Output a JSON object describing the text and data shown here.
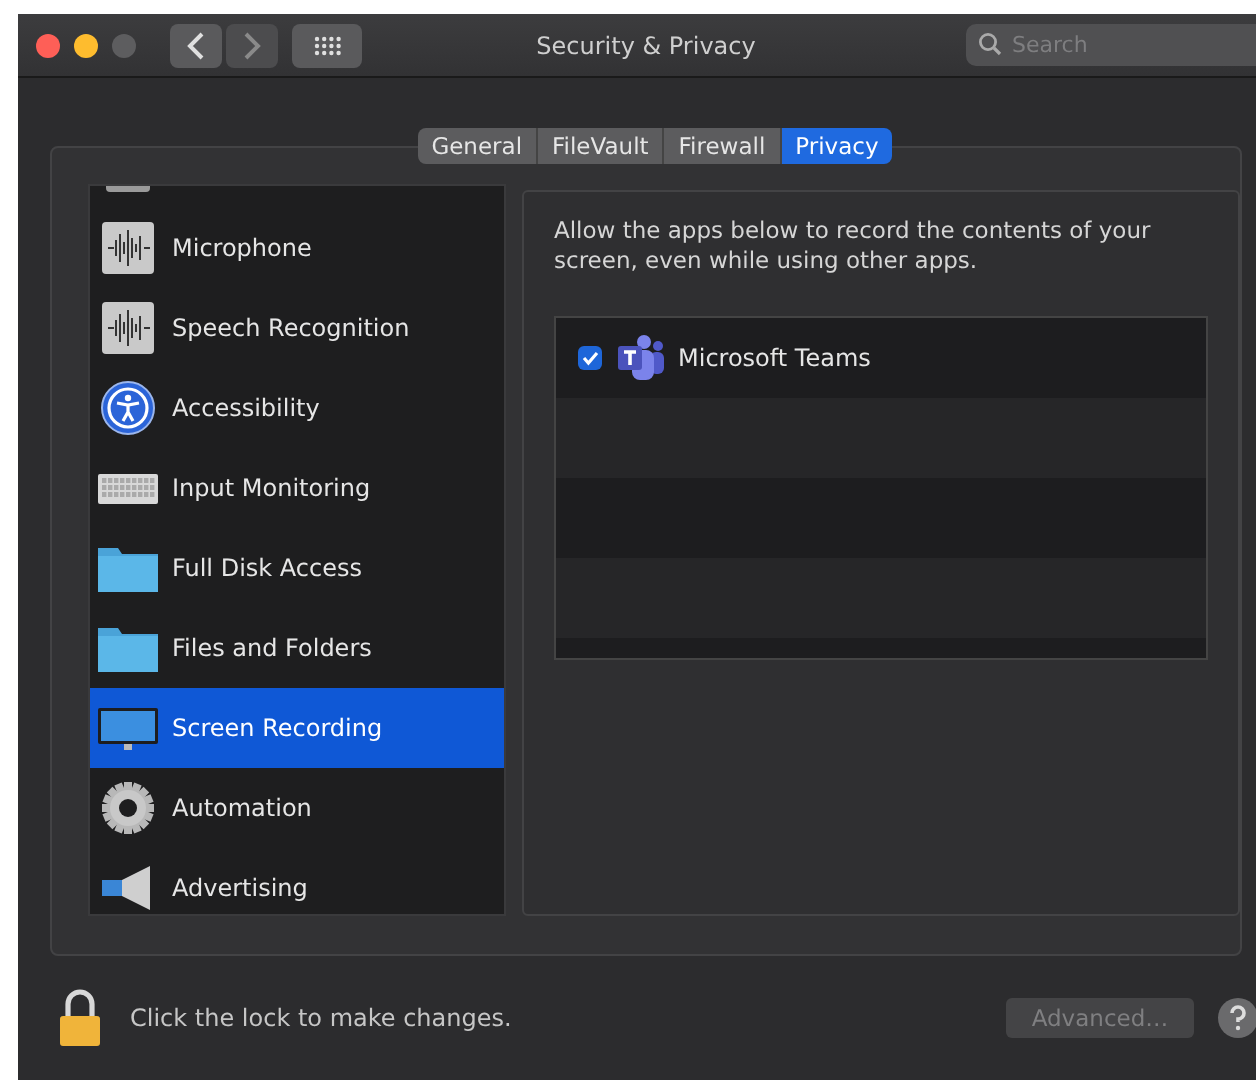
{
  "window": {
    "title": "Security & Privacy"
  },
  "search": {
    "placeholder": "Search"
  },
  "tabs": [
    {
      "label": "General",
      "selected": false
    },
    {
      "label": "FileVault",
      "selected": false
    },
    {
      "label": "Firewall",
      "selected": false
    },
    {
      "label": "Privacy",
      "selected": true
    }
  ],
  "sidebar": {
    "items": [
      {
        "label": "Microphone",
        "kind": "waveform",
        "selected": false
      },
      {
        "label": "Speech Recognition",
        "kind": "waveform",
        "selected": false
      },
      {
        "label": "Accessibility",
        "kind": "accessibility",
        "selected": false
      },
      {
        "label": "Input Monitoring",
        "kind": "keyboard",
        "selected": false
      },
      {
        "label": "Full Disk Access",
        "kind": "folder",
        "selected": false
      },
      {
        "label": "Files and Folders",
        "kind": "folder",
        "selected": false
      },
      {
        "label": "Screen Recording",
        "kind": "display",
        "selected": true
      },
      {
        "label": "Automation",
        "kind": "gear",
        "selected": false
      },
      {
        "label": "Advertising",
        "kind": "megaphone",
        "selected": false
      }
    ]
  },
  "description": "Allow the apps below to record the contents of your screen, even while using other apps.",
  "apps": [
    {
      "name": "Microsoft Teams",
      "checked": true
    }
  ],
  "footer": {
    "lock_text": "Click the lock to make changes.",
    "advanced_button": {
      "label": "Advanced…",
      "disabled": true
    }
  }
}
